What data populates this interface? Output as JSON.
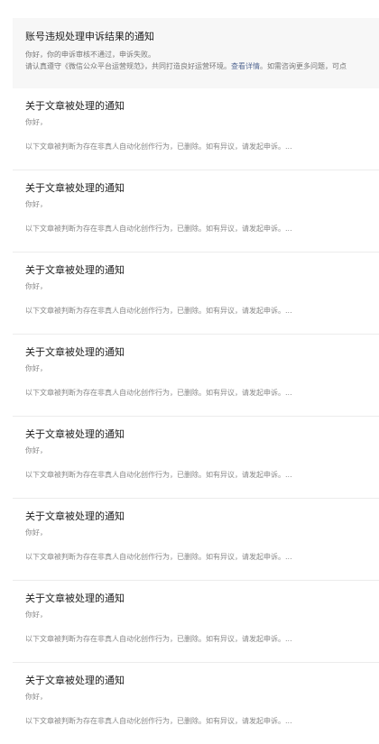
{
  "top_notice": {
    "title": "账号违规处理申诉结果的通知",
    "line1": "你好，你的申诉审核不通过，申诉失败。",
    "line2_before": "请认真遵守《微信公众平台运营规范》，共同打造良好运营环境。",
    "line2_link": "查看详情",
    "line2_after": "。如需咨询更多问题，可点"
  },
  "notices": [
    {
      "title": "关于文章被处理的通知",
      "greeting": "你好，",
      "body": "以下文章被判断为存在非真人自动化创作行为，已删除。如有异议，请发起申诉。..."
    },
    {
      "title": "关于文章被处理的通知",
      "greeting": "你好，",
      "body": "以下文章被判断为存在非真人自动化创作行为，已删除。如有异议，请发起申诉。..."
    },
    {
      "title": "关于文章被处理的通知",
      "greeting": "你好，",
      "body": "以下文章被判断为存在非真人自动化创作行为，已删除。如有异议，请发起申诉。..."
    },
    {
      "title": "关于文章被处理的通知",
      "greeting": "你好，",
      "body": "以下文章被判断为存在非真人自动化创作行为，已删除。如有异议，请发起申诉。..."
    },
    {
      "title": "关于文章被处理的通知",
      "greeting": "你好，",
      "body": "以下文章被判断为存在非真人自动化创作行为，已删除。如有异议，请发起申诉。..."
    },
    {
      "title": "关于文章被处理的通知",
      "greeting": "你好，",
      "body": "以下文章被判断为存在非真人自动化创作行为，已删除。如有异议，请发起申诉。..."
    },
    {
      "title": "关于文章被处理的通知",
      "greeting": "你好，",
      "body": "以下文章被判断为存在非真人自动化创作行为，已删除。如有异议，请发起申诉。..."
    },
    {
      "title": "关于文章被处理的通知",
      "greeting": "你好，",
      "body": "以下文章被判断为存在非真人自动化创作行为，已删除。如有异议，请发起申诉。..."
    }
  ],
  "colors": {
    "link": "#576b95",
    "highlight_bg": "#f7f7f7",
    "divider": "#ececec"
  }
}
